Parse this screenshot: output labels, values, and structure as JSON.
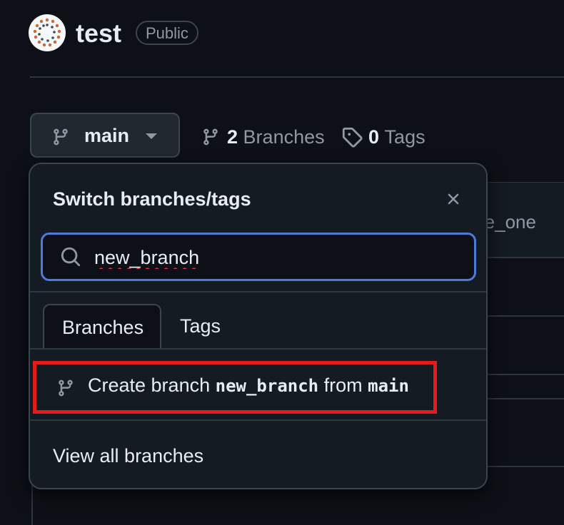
{
  "repo": {
    "name": "test",
    "visibility": "Public"
  },
  "branch_selector": {
    "current": "main"
  },
  "branches_link": {
    "count": "2",
    "label": "Branches"
  },
  "tags_link": {
    "count": "0",
    "label": "Tags"
  },
  "background": {
    "partial_text": "re_one"
  },
  "dropdown": {
    "title": "Switch branches/tags",
    "search_value": "new_branch",
    "tabs": [
      "Branches",
      "Tags"
    ],
    "active_tab": "Branches",
    "create_prefix": "Create branch",
    "create_branch_name": "new_branch",
    "create_from": "from",
    "create_source": "main",
    "view_all": "View all branches"
  },
  "colors": {
    "accent_focus": "#4f7bd8",
    "highlight_box": "#e31b1b",
    "background": "#0d1117"
  }
}
